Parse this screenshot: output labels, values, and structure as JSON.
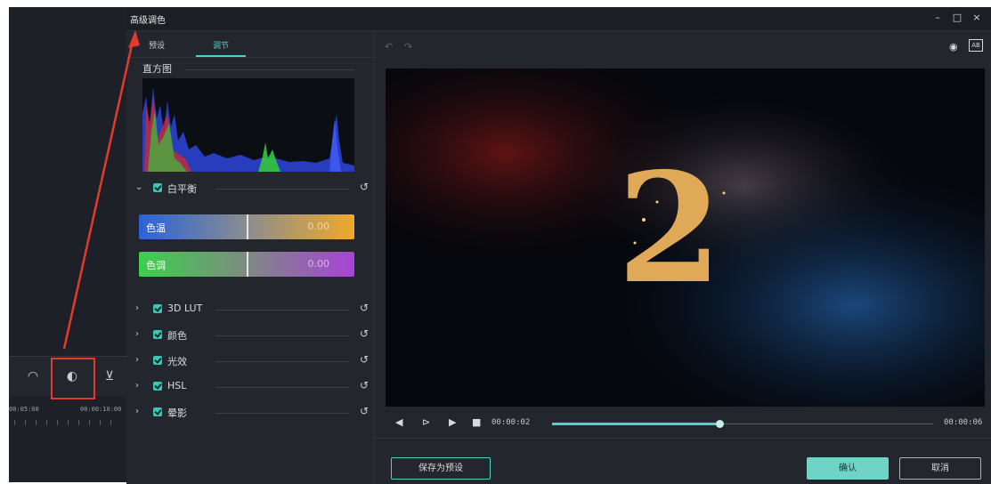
{
  "dialog": {
    "title": "高级调色",
    "window_controls": {
      "minimize": "–",
      "maximize": "□",
      "close": "×"
    }
  },
  "tabs": [
    {
      "label": "预设",
      "active": false
    },
    {
      "label": "调节",
      "active": true
    }
  ],
  "histogram": {
    "label": "直方图"
  },
  "white_balance": {
    "label": "白平衡",
    "expanded": true,
    "checked": true,
    "temperature": {
      "label": "色温",
      "value": "0.00",
      "level": 0.5
    },
    "tint": {
      "label": "色调",
      "value": "0.00",
      "level": 0.5
    }
  },
  "sections": [
    {
      "label": "3D LUT",
      "checked": true
    },
    {
      "label": "颜色",
      "checked": true
    },
    {
      "label": "光效",
      "checked": true
    },
    {
      "label": "HSL",
      "checked": true
    },
    {
      "label": "晕影",
      "checked": true
    }
  ],
  "preview": {
    "overlay_text": "2"
  },
  "playback": {
    "current_time": "00:00:02",
    "total_time": "00:00:06",
    "progress": 0.44
  },
  "buttons": {
    "save_preset": "保存为预设",
    "ok": "确认",
    "cancel": "取消"
  },
  "background_timeline": {
    "timecode_start": "00:05:00",
    "timecode_end": "00:00:10:00"
  },
  "colors": {
    "accent": "#4fd1c5",
    "annotation": "#e23a2e",
    "panel": "#23272d"
  }
}
